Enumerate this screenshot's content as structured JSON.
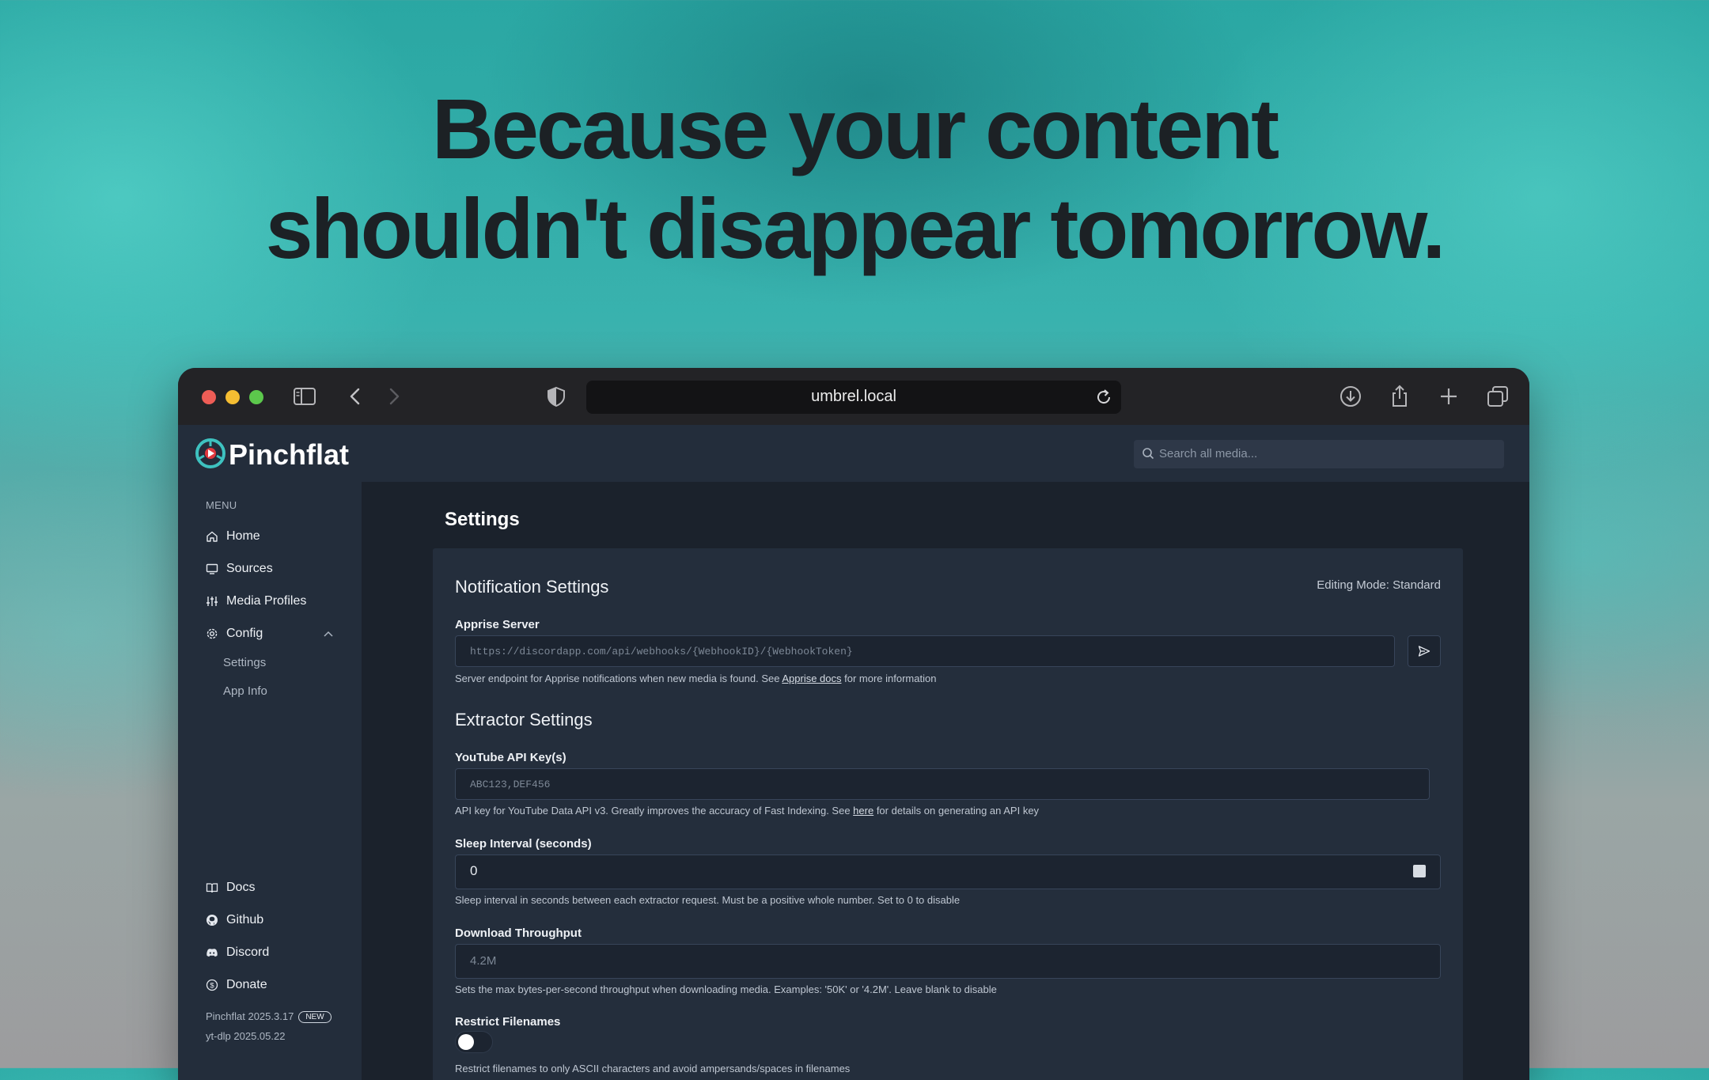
{
  "headline": {
    "line1": "Because your content",
    "line2": "shouldn't disappear tomorrow."
  },
  "browser": {
    "url": "umbrel.local",
    "icons": [
      "sidebar-toggle-icon",
      "back-icon",
      "forward-icon",
      "shield-icon",
      "reload-icon",
      "download-icon",
      "share-icon",
      "new-tab-icon",
      "tabs-overview-icon"
    ]
  },
  "app": {
    "name": "Pinchflat",
    "search_placeholder": "Search all media..."
  },
  "sidebar": {
    "menu_label": "MENU",
    "items": [
      {
        "label": "Home",
        "icon": "home-icon"
      },
      {
        "label": "Sources",
        "icon": "monitor-icon"
      },
      {
        "label": "Media Profiles",
        "icon": "sliders-icon"
      },
      {
        "label": "Config",
        "icon": "gear-icon"
      }
    ],
    "config_children": [
      "Settings",
      "App Info"
    ],
    "footer_items": [
      {
        "label": "Docs",
        "icon": "book-icon"
      },
      {
        "label": "Github",
        "icon": "github-icon"
      },
      {
        "label": "Discord",
        "icon": "discord-icon"
      },
      {
        "label": "Donate",
        "icon": "dollar-icon"
      }
    ],
    "version": "Pinchflat 2025.3.17",
    "version_badge": "NEW",
    "ytdlp_version": "yt-dlp 2025.05.22"
  },
  "settings": {
    "page_title": "Settings",
    "editing_mode": "Editing Mode: Standard",
    "notification_title": "Notification Settings",
    "apprise_label": "Apprise Server",
    "apprise_placeholder": "https://discordapp.com/api/webhooks/{WebhookID}/{WebhookToken}",
    "apprise_help_prefix": "Server endpoint for Apprise notifications when new media is found. See ",
    "apprise_help_link": "Apprise docs",
    "apprise_help_suffix": " for more information",
    "extractor_title": "Extractor Settings",
    "youtube_label": "YouTube API Key(s)",
    "youtube_placeholder": "ABC123,DEF456",
    "youtube_help_prefix": "API key for YouTube Data API v3. Greatly improves the accuracy of Fast Indexing. See ",
    "youtube_help_link": "here",
    "youtube_help_suffix": " for details on generating an API key",
    "sleep_label": "Sleep Interval (seconds)",
    "sleep_value": "0",
    "sleep_help": "Sleep interval in seconds between each extractor request. Must be a positive whole number. Set to 0 to disable",
    "throughput_label": "Download Throughput",
    "throughput_placeholder": "4.2M",
    "throughput_help": "Sets the max bytes-per-second throughput when downloading media. Examples: '50K' or '4.2M'. Leave blank to disable",
    "restrict_label": "Restrict Filenames",
    "restrict_enabled": false,
    "restrict_help": "Restrict filenames to only ASCII characters and avoid ampersands/spaces in filenames"
  }
}
